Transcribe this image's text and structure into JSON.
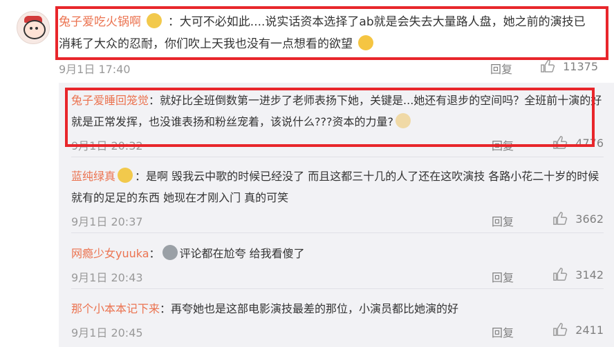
{
  "main": {
    "username": "兔子爱吃火锅啊",
    "content": "：大可不必如此....说实话资本选择了ab就是会失去大量路人盘，她之前的演技已消耗了大众的忍耐，你们吹上天我也没有一点想看的欲望",
    "time": "9月1日 17:40",
    "reply_label": "回复",
    "likes": "11375"
  },
  "replies": [
    {
      "username": "兔子爱睡回笼觉",
      "content": "：就好比全班倒数第一进步了老师表扬下她，关键是...她还有退步的空间吗？全班前十演的好就是正常发挥，也没谁表扬和粉丝宠着，该说什么???资本的力量?",
      "time": "9月1日 20:32",
      "reply_label": "回复",
      "likes": "4776"
    },
    {
      "username": "蓝纯绿真",
      "content": "：是啊 毁我云中歌的时候已经没了 而且这都三十几的人了还在这吹演技 各路小花二十岁的时候就有的足足的东西 她现在才刚入门 真的可笑",
      "time": "9月1日 20:37",
      "reply_label": "回复",
      "likes": "3662"
    },
    {
      "username": "网瘾少女yuuka",
      "content": "评论都在尬夸 给我看傻了",
      "time": "9月1日 20:43",
      "reply_label": "回复",
      "likes": "3142"
    },
    {
      "username": "那个小本本记下来",
      "content": "：再夸她也是这部电影演技最差的那位，小演员都比她演的好",
      "time": "9月1日 20:45",
      "reply_label": "回复",
      "likes": "2411"
    }
  ],
  "icons": {
    "like": "thumbs-up-icon",
    "crown_badge": "crown-emoji-icon",
    "shrug": "shrug-emoji-icon",
    "dog": "doge-emoji-icon",
    "surprise": "surprised-emoji-icon"
  },
  "colors": {
    "username": "#eb7350",
    "highlight_box": "#e8262b",
    "reply_bg": "#f2f2f5"
  }
}
